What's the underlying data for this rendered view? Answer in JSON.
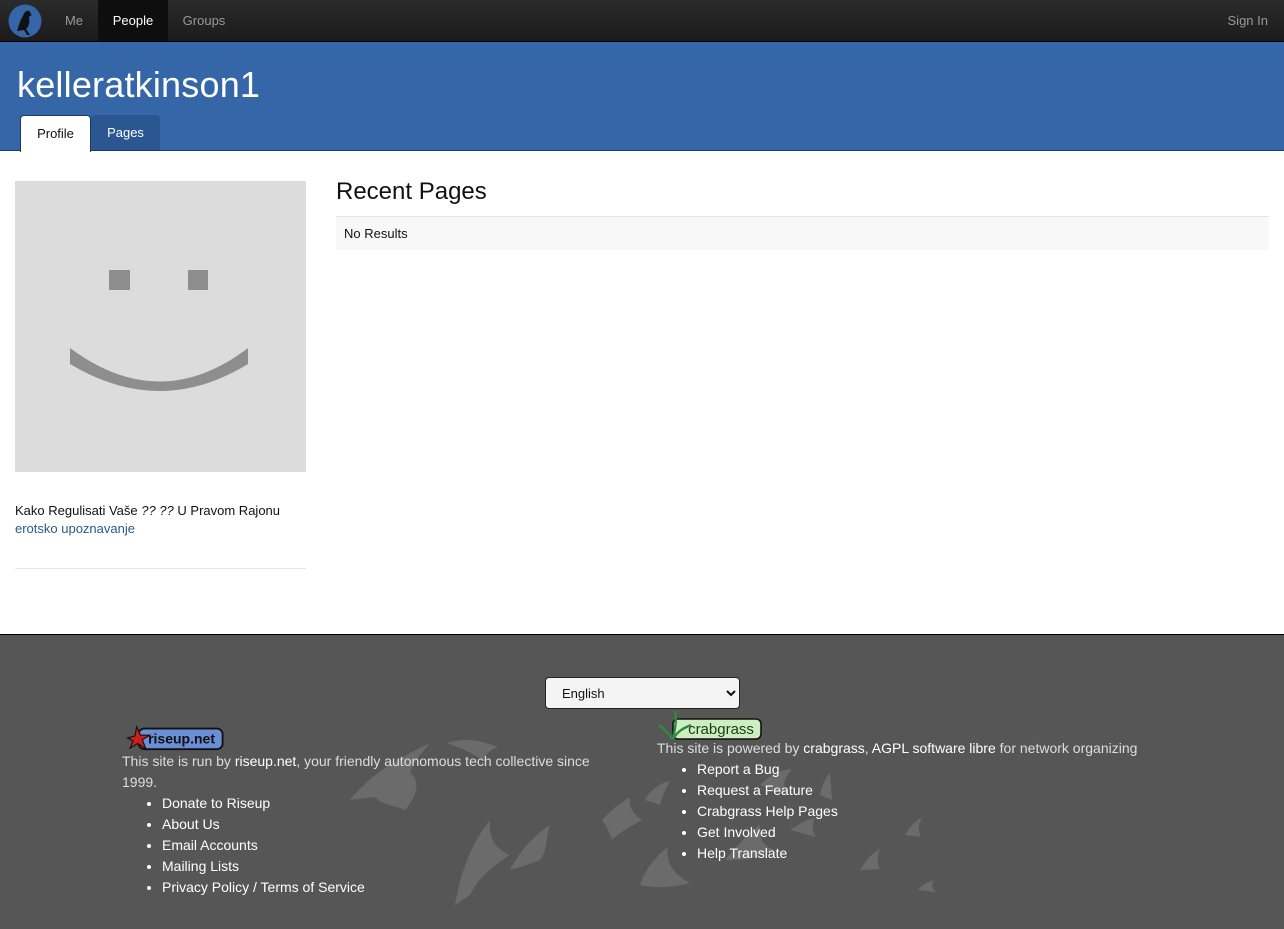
{
  "nav": {
    "me": "Me",
    "people": "People",
    "groups": "Groups",
    "sign_in": "Sign In"
  },
  "banner": {
    "title": "kelleratkinson1",
    "tabs": [
      "Profile",
      "Pages"
    ]
  },
  "profile": {
    "description_prefix": "Kako Regulisati Vaše",
    "description_italic": "?? ??",
    "description_suffix": "U Pravom Rajonu",
    "link": "erotsko upoznavanje"
  },
  "main": {
    "recent_title": "Recent Pages",
    "no_results": "No Results"
  },
  "footer": {
    "language": "English",
    "left": {
      "badge": "riseup.net",
      "intro_prefix": "This site is run by",
      "intro_link": "riseup.net",
      "intro_suffix": ", your friendly autonomous tech collective since 1999.",
      "links": [
        "Donate to Riseup",
        "About Us",
        "Email Accounts",
        "Mailing Lists",
        "Privacy Policy / Terms of Service"
      ]
    },
    "right": {
      "badge": "crabgrass",
      "intro_prefix": "This site is powered by",
      "intro_link1": "crabgrass",
      "intro_sep": ",",
      "intro_link2": "AGPL software libre",
      "intro_suffix": "for network organizing",
      "links": [
        "Report a Bug",
        "Request a Feature",
        "Crabgrass Help Pages",
        "Get Involved",
        "Help Translate"
      ]
    }
  },
  "colors": {
    "banner": "#3566a8",
    "navbar": "#222222",
    "footer": "#565656",
    "link": "#2a5a8a"
  }
}
